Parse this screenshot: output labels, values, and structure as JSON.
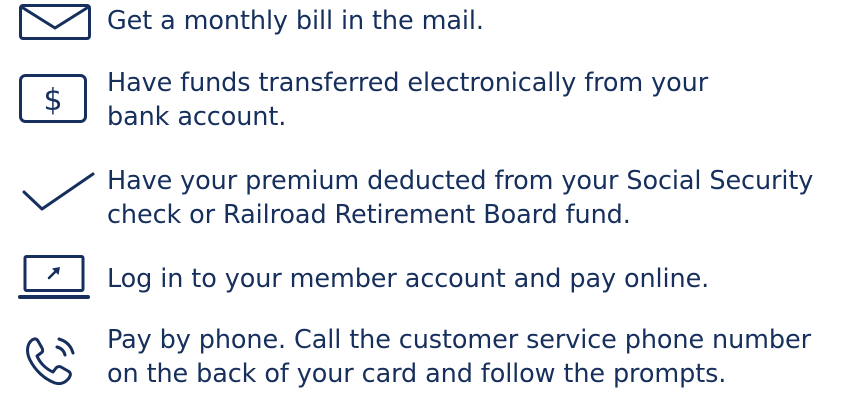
{
  "colors": {
    "text": "#162f5c",
    "icon_stroke": "#162f5c",
    "background": "#ffffff"
  },
  "payment_options": [
    {
      "icon": "envelope-icon",
      "lines": [
        "Get a monthly bill in the mail."
      ]
    },
    {
      "icon": "dollar-icon",
      "icon_text": "$",
      "lines": [
        "Have funds transferred electronically from your",
        "bank account."
      ]
    },
    {
      "icon": "checkmark-icon",
      "lines": [
        "Have your premium deducted from your Social Security",
        "check or Railroad Retirement Board fund."
      ]
    },
    {
      "icon": "laptop-icon",
      "lines": [
        "Log in to your member account and pay online."
      ]
    },
    {
      "icon": "phone-icon",
      "lines": [
        "Pay by phone. Call the customer service phone number",
        "on the back of your card and follow the prompts."
      ]
    }
  ]
}
